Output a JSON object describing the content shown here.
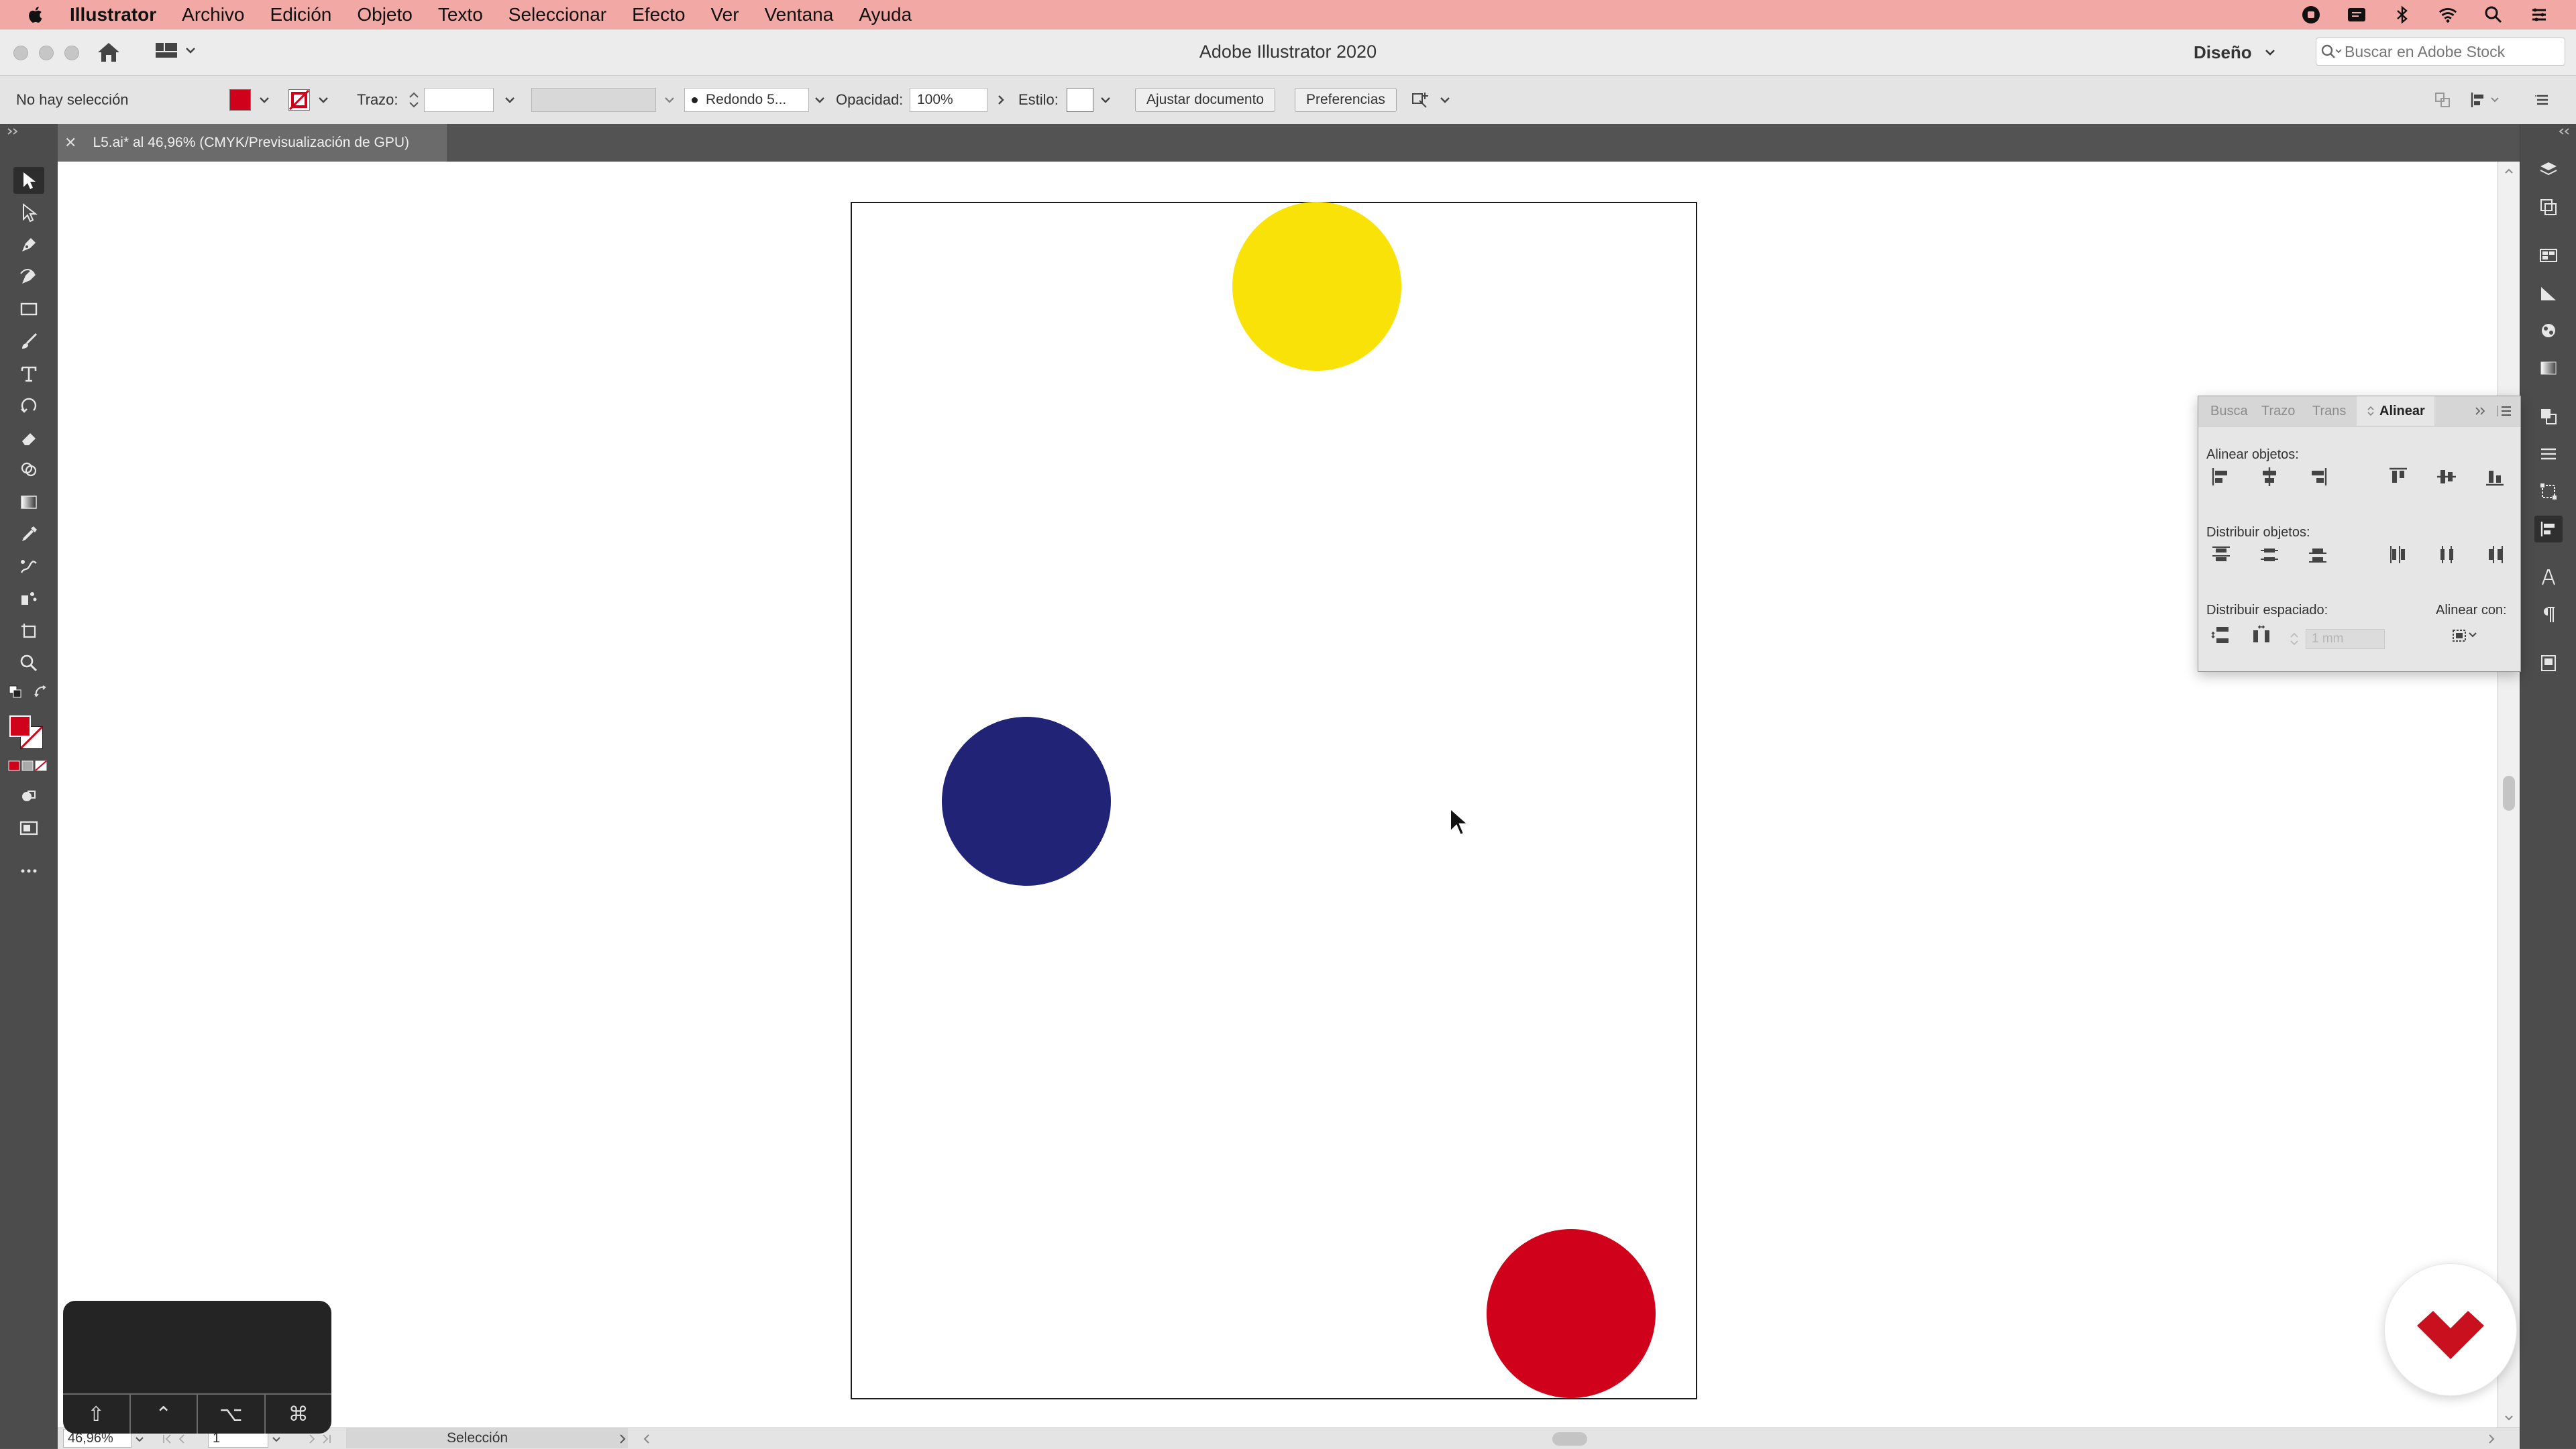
{
  "menubar": {
    "app": "Illustrator",
    "items": [
      "Archivo",
      "Edición",
      "Objeto",
      "Texto",
      "Seleccionar",
      "Efecto",
      "Ver",
      "Ventana",
      "Ayuda"
    ],
    "status_icons": [
      "record-icon",
      "notes-icon",
      "bluetooth-icon",
      "wifi-icon",
      "spotlight-icon",
      "control-center-icon"
    ]
  },
  "window": {
    "title": "Adobe Illustrator 2020",
    "workspace": "Diseño",
    "stock_search_placeholder": "Buscar en Adobe Stock"
  },
  "control_bar": {
    "selection_status": "No hay selección",
    "fill_color": "#d0021b",
    "stroke_label": "Trazo:",
    "brush_label": "Redondo 5...",
    "opacity_label": "Opacidad:",
    "opacity_value": "100%",
    "style_label": "Estilo:",
    "fit_document_button": "Ajustar documento",
    "preferences_button": "Preferencias"
  },
  "document_tab": {
    "title": "L5.ai* al 46,96% (CMYK/Previsualización de GPU)"
  },
  "artwork": {
    "circles": [
      {
        "name": "yellow-circle",
        "color": "#f9e207"
      },
      {
        "name": "blue-circle",
        "color": "#212476"
      },
      {
        "name": "red-circle",
        "color": "#d0021b"
      }
    ]
  },
  "align_panel": {
    "tabs": [
      "Busca",
      "Trazo",
      "Trans",
      "Alinear"
    ],
    "active_tab": "Alinear",
    "align_objects_label": "Alinear objetos:",
    "distribute_objects_label": "Distribuir objetos:",
    "distribute_spacing_label": "Distribuir espaciado:",
    "align_to_label": "Alinear con:",
    "spacing_value": "1 mm"
  },
  "status_bar": {
    "zoom": "46,96%",
    "artboard_number": "1",
    "tool_name": "Selección"
  },
  "key_overlay": {
    "keys": [
      "⇧",
      "⌃",
      "⌥",
      "⌘"
    ]
  }
}
